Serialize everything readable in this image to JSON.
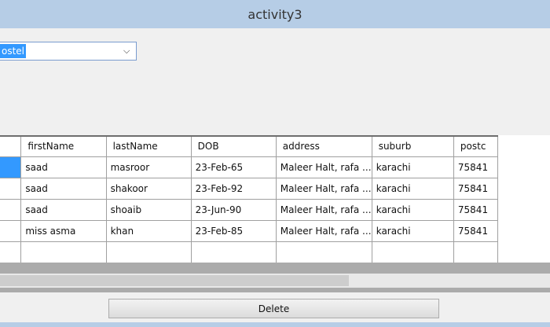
{
  "window": {
    "title": "activity3"
  },
  "combo": {
    "selected": "ostel"
  },
  "grid": {
    "columns": [
      "",
      "firstName",
      "lastName",
      "DOB",
      "address",
      "suburb",
      "postc"
    ],
    "rows": [
      [
        "",
        "saad",
        "masroor",
        "23-Feb-65",
        "Maleer Halt, rafa ...",
        "karachi",
        "75841"
      ],
      [
        "",
        "saad",
        "shakoor",
        "23-Feb-92",
        "Maleer Halt, rafa ...",
        "karachi",
        "75841"
      ],
      [
        "",
        "saad",
        "shoaib",
        "23-Jun-90",
        "Maleer Halt, rafa ...",
        "karachi",
        "75841"
      ],
      [
        "",
        "miss asma",
        "khan",
        "23-Feb-85",
        "Maleer Halt, rafa ...",
        "karachi",
        "75841"
      ],
      [
        "",
        "",
        "",
        "",
        "",
        "",
        ""
      ]
    ]
  },
  "actions": {
    "delete_label": "Delete"
  }
}
